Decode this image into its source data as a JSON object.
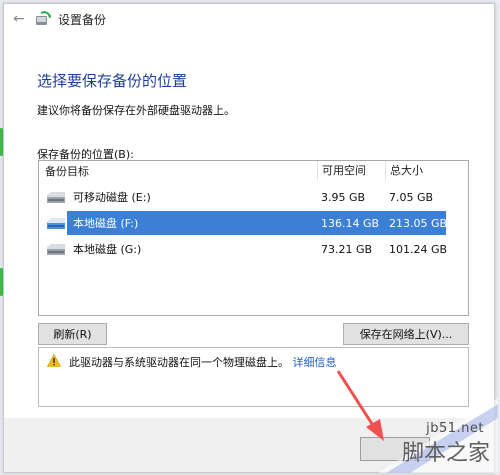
{
  "window": {
    "title": "设置备份",
    "back_icon": "back-arrow-icon"
  },
  "heading": "选择要保存备份的位置",
  "subtext": "建议你将备份保存在外部硬盘驱动器上。",
  "list": {
    "label": "保存备份的位置(B):",
    "columns": [
      "备份目标",
      "可用空间",
      "总大小"
    ],
    "rows": [
      {
        "name": "可移动磁盘 (E:)",
        "free": "3.95 GB",
        "total": "7.05 GB",
        "selected": false
      },
      {
        "name": "本地磁盘 (F:)",
        "free": "136.14 GB",
        "total": "213.05 GB",
        "selected": true
      },
      {
        "name": "本地磁盘 (G:)",
        "free": "73.21 GB",
        "total": "101.24 GB",
        "selected": false
      }
    ]
  },
  "buttons": {
    "refresh": "刷新(R)",
    "save_network": "保存在网络上(V)..."
  },
  "warning": {
    "text": "此驱动器与系统驱动器在同一个物理磁盘上。",
    "link": "详细信息"
  },
  "watermark": {
    "site": "jb51.net",
    "name": "脚本之家"
  },
  "colors": {
    "accent": "#3b7fd6",
    "heading": "#1f3f98",
    "link": "#1f5fc8"
  }
}
